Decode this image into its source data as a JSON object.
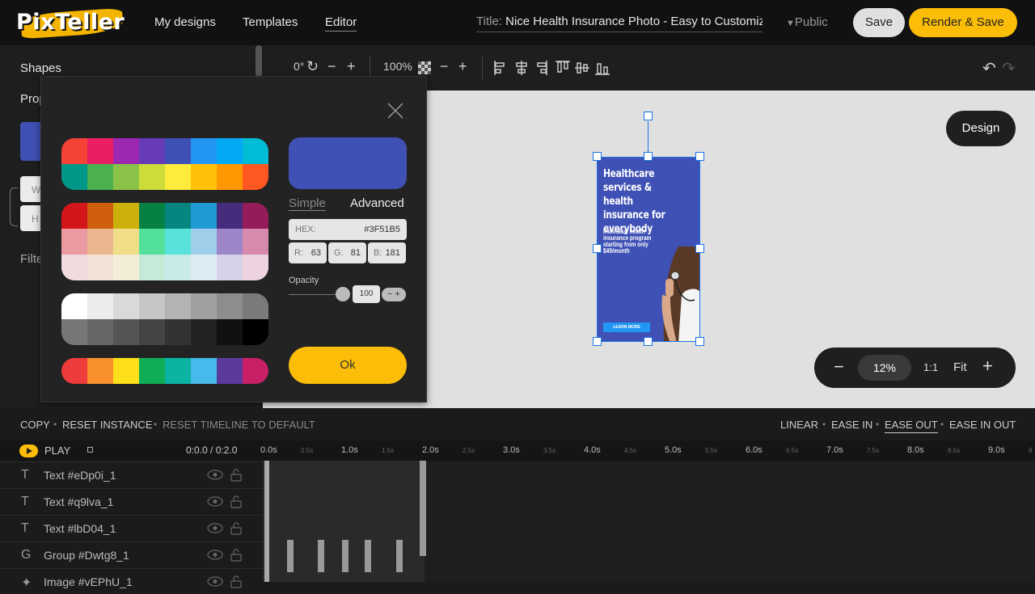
{
  "header": {
    "logo": "PixTeller",
    "nav": [
      "My designs",
      "Templates",
      "Editor"
    ],
    "title_label": "Title:",
    "title_value": "Nice Health Insurance Photo - Easy to Customize",
    "visibility": "Public",
    "save": "Save",
    "render_save": "Render & Save"
  },
  "left_panel": {
    "shapes": "Shapes",
    "properties": "Prop",
    "w": "W",
    "h": "H",
    "filters": "Filte",
    "swatch_color": "#3F51B5"
  },
  "toolbar": {
    "rotation": "0°",
    "opacity": "100%"
  },
  "canvas": {
    "design_button": "Design",
    "headline": "Healthcare services & health insurance for everybody",
    "subline": "Individual health insurance program starting from only $49/month",
    "cta": "LEARN MORE",
    "zoom": "12%",
    "zoom_1to1": "1:1",
    "zoom_fit": "Fit"
  },
  "color_picker": {
    "tab_simple": "Simple",
    "tab_advanced": "Advanced",
    "hex_label": "HEX:",
    "hex_value": "#3F51B5",
    "r_label": "R:",
    "r_value": "63",
    "g_label": "G:",
    "g_value": "81",
    "b_label": "B:",
    "b_value": "181",
    "opacity_label": "Opacity",
    "opacity_value": "100",
    "ok": "Ok",
    "preview_color": "#3F51B5",
    "palettes": [
      [
        "#f44336",
        "#e91e63",
        "#9c27b0",
        "#673ab7",
        "#3f51b5",
        "#2196f3",
        "#03a9f4",
        "#00bcd4",
        "#009688",
        "#4caf50",
        "#8bc34a",
        "#cddc39",
        "#ffeb3b",
        "#ffc107",
        "#ff9800",
        "#ff5722"
      ],
      [
        "#d2161a",
        "#cf5f0c",
        "#ccb10a",
        "#048143",
        "#078681",
        "#1f9ad3",
        "#462c7c",
        "#961c59",
        "#ea9aa0",
        "#ebb68f",
        "#efdd88",
        "#53e09b",
        "#59e2dc",
        "#9fcee8",
        "#9c86c8",
        "#d88aae",
        "#f0dcde",
        "#f2e2d5",
        "#f3edd8",
        "#c6e9d8",
        "#c8ebea",
        "#dcebf1",
        "#d8d2e8",
        "#edd2e0"
      ],
      [
        "#ffffff",
        "#ececec",
        "#d9d9d9",
        "#c6c6c6",
        "#b3b3b3",
        "#a0a0a0",
        "#8d8d8d",
        "#7a7a7a",
        "#777777",
        "#666666",
        "#555555",
        "#444444",
        "#333333",
        "#222222",
        "#111111",
        "#000000"
      ],
      [
        "#ee3b3b",
        "#f7902d",
        "#fde01a",
        "#0fad55",
        "#0bb3a3",
        "#47b9ea",
        "#5c3a9c",
        "#c91f67"
      ]
    ]
  },
  "timeline": {
    "actions_left": [
      "COPY",
      "RESET INSTANCE",
      "RESET TIMELINE TO DEFAULT"
    ],
    "actions_right": [
      "LINEAR",
      "EASE IN",
      "EASE OUT",
      "EASE IN OUT"
    ],
    "play": "PLAY",
    "time": "0:0.0 / 0:2.0",
    "ticks": [
      "0.0s",
      "0.5s",
      "1.0s",
      "1.5s",
      "2.0s",
      "2.5s",
      "3.0s",
      "3.5s",
      "4.0s",
      "4.5s",
      "5.0s",
      "5.5s",
      "6.0s",
      "6.5s",
      "7.0s",
      "7.5s",
      "8.0s",
      "8.5s",
      "9.0s",
      "9"
    ],
    "tracks": [
      {
        "icon": "T",
        "name": "Text #eDp0i_1"
      },
      {
        "icon": "T",
        "name": "Text #q9lva_1"
      },
      {
        "icon": "T",
        "name": "Text #lbD04_1"
      },
      {
        "icon": "G",
        "name": "Group #Dwtg8_1"
      },
      {
        "icon": "✦",
        "name": "Image #vEPhU_1"
      }
    ]
  }
}
